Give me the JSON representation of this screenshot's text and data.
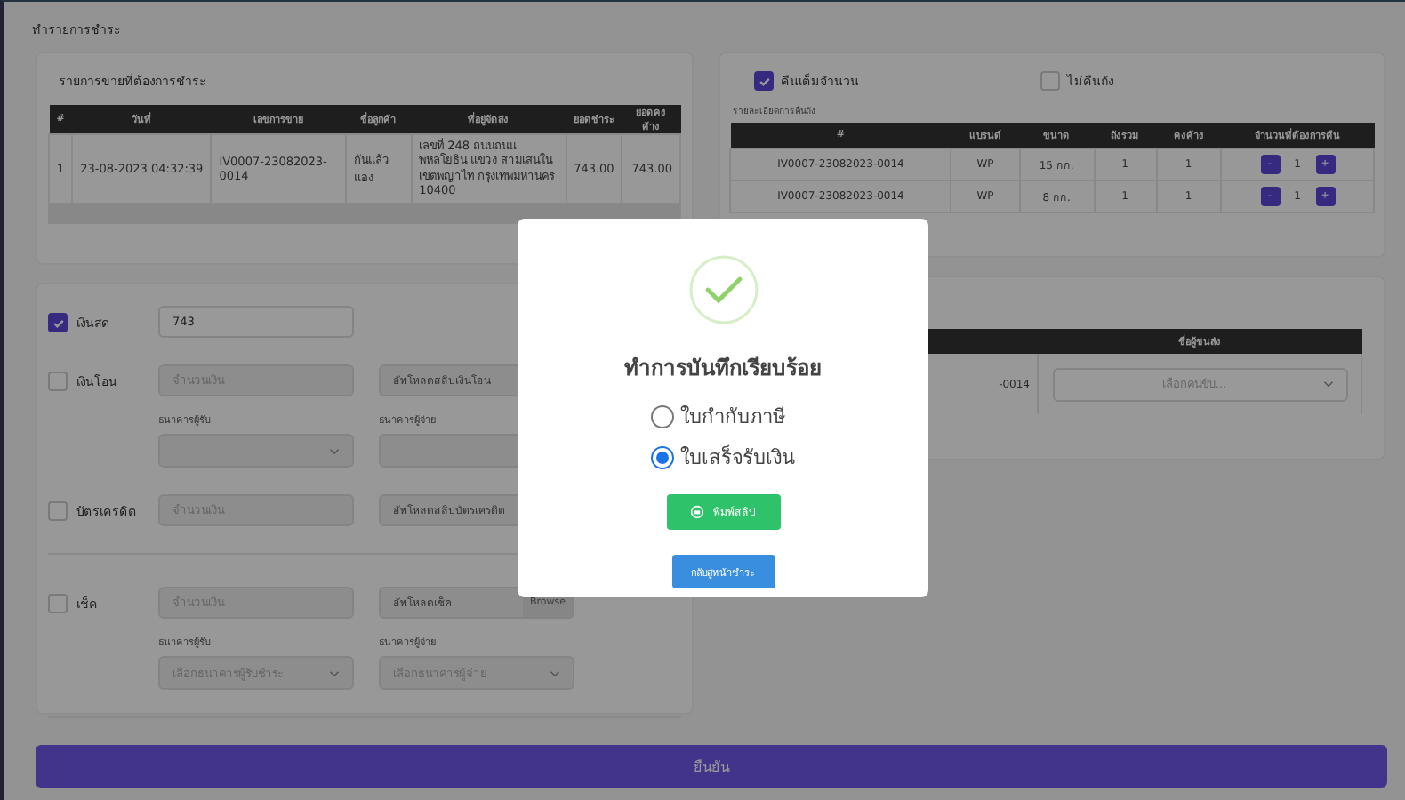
{
  "page_title": "ทำรายการชำระ",
  "sales_card": {
    "title": "รายการขายที่ต้องการชำระ",
    "columns": [
      "#",
      "วันที่",
      "เลขการขาย",
      "ชื่อลูกค้า",
      "ที่อยู่จัดส่ง",
      "ยอดชำระ",
      "ยอดคงค้าง"
    ],
    "rows": [
      [
        "1",
        "23-08-2023 04:32:39",
        "IV0007-23082023-0014",
        "กันแล้ว แอง",
        "เลขที่ 248 ถนนถนน พหลโยธิน แขวง สามเสนใน เขตพญาไท กรุงเทพมหานคร 10400",
        "743.00",
        "743.00"
      ]
    ]
  },
  "return_card": {
    "options": [
      {
        "label": "คืนเต็มจำนวน",
        "checked": true
      },
      {
        "label": "ไม่คืนถัง",
        "checked": false
      }
    ],
    "subtitle": "รายละเอียดการคืนถัง",
    "columns": [
      "#",
      "แบรนด์",
      "ขนาด",
      "ถังรวม",
      "คงค้าง",
      "จำนวนที่ต้องการคืน"
    ],
    "rows": [
      {
        "cells": [
          "IV0007-23082023-0014",
          "WP",
          "15 กก.",
          "1",
          "1"
        ],
        "minus": "-",
        "quantity": "1",
        "plus": "+"
      },
      {
        "cells": [
          "IV0007-23082023-0014",
          "WP",
          "8 กก.",
          "1",
          "1"
        ],
        "minus": "-",
        "quantity": "1",
        "plus": "+"
      }
    ]
  },
  "payments": [
    {
      "kind": "cash",
      "label": "เงินสด",
      "checked": true,
      "value": "743"
    },
    {
      "kind": "transfer",
      "label": "เงินโอน",
      "checked": false,
      "amount_placeholder": "จำนวนเงิน",
      "upload_placeholder": "อัพโหลดสลิปเงินโอน",
      "receiver_label": "ธนาคารผู้รับ",
      "payer_label": "ธนาคารผู้จ่าย"
    },
    {
      "kind": "credit",
      "label": "บัตรเครดิต",
      "checked": false,
      "amount_placeholder": "จำนวนเงิน",
      "upload_placeholder": "อัพโหลดสลิปบัตรเครดิต"
    },
    {
      "kind": "cheque",
      "label": "เช็ค",
      "checked": false,
      "amount_placeholder": "จำนวนเงิน",
      "upload_placeholder": "อัพโหลดเช็ค",
      "browse": "Browse",
      "receiver_label": "ธนาคารผู้รับ",
      "receiver_placeholder": "เลือกธนาคารผู้รับชำระ",
      "payer_label": "ธนาคารผู้จ่าย",
      "payer_placeholder": "เลือกธนาคารผู้จ่าย"
    }
  ],
  "driver_card": {
    "column": "ชื่อผู้ขนส่ง",
    "row_text": "-0014",
    "select_placeholder": "เลือกคนขับ..."
  },
  "confirm_button": "ยืนยัน",
  "modal": {
    "title": "ทำการบันทึกเรียบร้อย",
    "options": [
      {
        "label": "ใบกำกับภาษี",
        "selected": false
      },
      {
        "label": "ใบเสร็จรับเงิน",
        "selected": true
      }
    ],
    "print_button": "พิมพ์สลิป",
    "back_button": "กลับสู่หน้าชำระ"
  }
}
